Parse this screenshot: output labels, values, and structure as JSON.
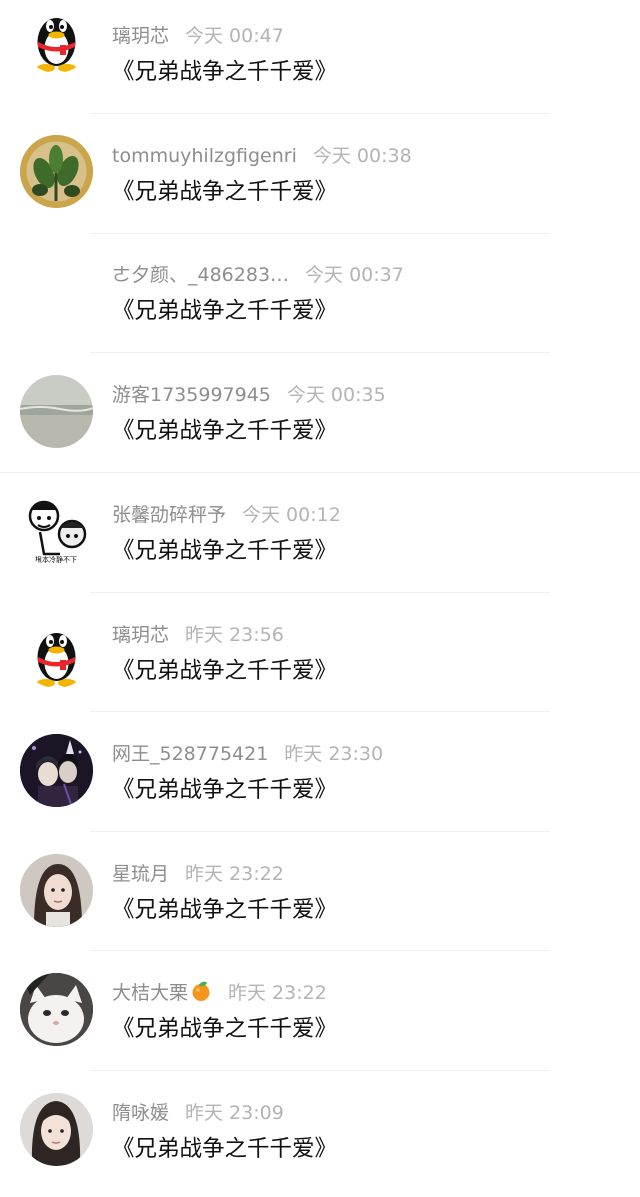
{
  "messages": [
    {
      "name": "璃玥芯",
      "time": "今天 00:47",
      "text": "《兄弟战争之千千爱》",
      "avatar_icon": "qq-penguin-avatar",
      "has_avatar": true
    },
    {
      "name": "tommuyhilzgfigenri",
      "time": "今天 00:38",
      "text": "《兄弟战争之千千爱》",
      "avatar_icon": "plant-painting-avatar",
      "has_avatar": true
    },
    {
      "name": "ㄜ夕颜、_486283…",
      "time": "今天 00:37",
      "text": "《兄弟战争之千千爱》",
      "avatar_icon": "",
      "has_avatar": false
    },
    {
      "name": "游客1735997945",
      "time": "今天 00:35",
      "text": "《兄弟战争之千千爱》",
      "avatar_icon": "sea-photo-avatar",
      "has_avatar": true
    },
    {
      "name": "张馨劭碎秤予",
      "time": "今天 00:12",
      "text": "《兄弟战争之千千爱》",
      "avatar_icon": "meme-cartoon-avatar",
      "has_avatar": true
    },
    {
      "name": "璃玥芯",
      "time": "昨天 23:56",
      "text": "《兄弟战争之千千爱》",
      "avatar_icon": "qq-penguin-avatar",
      "has_avatar": true
    },
    {
      "name": "网王_528775421",
      "time": "昨天 23:30",
      "text": "《兄弟战争之千千爱》",
      "avatar_icon": "anime-characters-avatar",
      "has_avatar": true
    },
    {
      "name": "星琉月",
      "time": "昨天 23:22",
      "text": "《兄弟战争之千千爱》",
      "avatar_icon": "girl-photo-avatar",
      "has_avatar": true
    },
    {
      "name": "大桔大栗",
      "time": "昨天 23:22",
      "text": "《兄弟战争之千千爱》",
      "avatar_icon": "cat-photo-avatar",
      "has_avatar": true,
      "name_emoji": "orange-emoji"
    },
    {
      "name": "隋咏媛",
      "time": "昨天 23:09",
      "text": "《兄弟战争之千千爱》",
      "avatar_icon": "girl-selfie-avatar",
      "has_avatar": true
    }
  ],
  "colors": {
    "name_text": "#8e8e8e",
    "time_text": "#b4b4b4",
    "message_text": "#111111",
    "divider": "#efefef",
    "qq_red_scarf": "#e8262b",
    "qq_yellow": "#f5b400",
    "orange_emoji": "#f7941d"
  }
}
